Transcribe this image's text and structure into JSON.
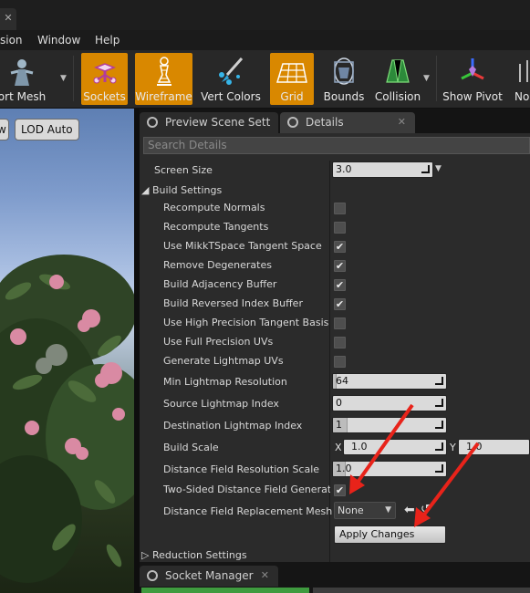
{
  "window": {
    "tab_close": "✕"
  },
  "menu": {
    "items": [
      "sion",
      "Window",
      "Help"
    ]
  },
  "toolbar": {
    "items": [
      {
        "label": "ort Mesh",
        "active": false
      },
      {
        "label": "Sockets",
        "active": true
      },
      {
        "label": "Wireframe",
        "active": true
      },
      {
        "label": "Vert Colors",
        "active": false
      },
      {
        "label": "Grid",
        "active": true
      },
      {
        "label": "Bounds",
        "active": false
      },
      {
        "label": "Collision",
        "active": false
      },
      {
        "label": "Show Pivot",
        "active": false
      },
      {
        "label": "No",
        "active": false
      }
    ]
  },
  "viewport": {
    "view_button": "w",
    "lod_button": "LOD Auto"
  },
  "panel_tabs": {
    "preview_scene": "Preview Scene Sett",
    "details": "Details",
    "close": "✕"
  },
  "details": {
    "search_placeholder": "Search Details",
    "screen_size": {
      "label": "Screen Size",
      "value": "3.0"
    },
    "build_settings_header": "Build Settings",
    "checkboxes": [
      {
        "label": "Recompute Normals",
        "checked": false
      },
      {
        "label": "Recompute Tangents",
        "checked": false
      },
      {
        "label": "Use MikkTSpace Tangent Space",
        "checked": true
      },
      {
        "label": "Remove Degenerates",
        "checked": true
      },
      {
        "label": "Build Adjacency Buffer",
        "checked": true
      },
      {
        "label": "Build Reversed Index Buffer",
        "checked": true
      },
      {
        "label": "Use High Precision Tangent Basis",
        "checked": false
      },
      {
        "label": "Use Full Precision UVs",
        "checked": false
      },
      {
        "label": "Generate Lightmap UVs",
        "checked": false
      }
    ],
    "min_lightmap_resolution": {
      "label": "Min Lightmap Resolution",
      "value": "64"
    },
    "source_lightmap_index": {
      "label": "Source Lightmap Index",
      "value": "0"
    },
    "destination_lightmap_index": {
      "label": "Destination Lightmap Index",
      "value": "1"
    },
    "build_scale": {
      "label": "Build Scale",
      "x_axis": "X",
      "x_value": "1.0",
      "y_axis": "Y",
      "y_value": "1.0"
    },
    "distance_field_resolution_scale": {
      "label": "Distance Field Resolution Scale",
      "value": "1.0"
    },
    "two_sided_distance_field": {
      "label": "Two-Sided Distance Field Generatio",
      "checked": true
    },
    "distance_field_replacement_mesh": {
      "label": "Distance Field Replacement Mesh",
      "value": "None"
    },
    "apply_changes": "Apply Changes",
    "reduction_settings_header": "Reduction Settings"
  },
  "bottom_tabs": {
    "socket_manager": "Socket Manager",
    "close": "✕"
  },
  "colors": {
    "accent_orange": "#d98800",
    "annotation_red": "#e8231a",
    "panel_bg": "#2b2b2b"
  }
}
